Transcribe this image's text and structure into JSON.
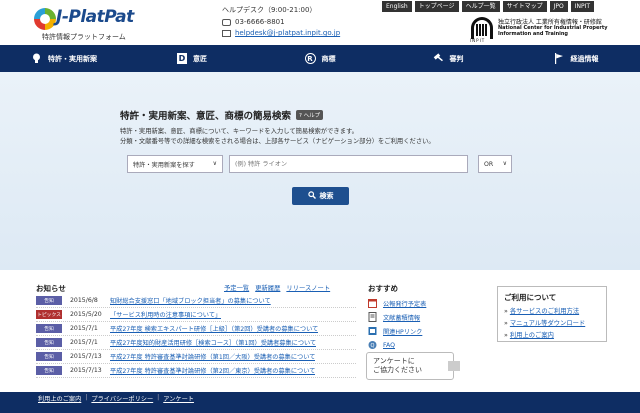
{
  "header": {
    "logo_text": "J-PlatPat",
    "logo_subtitle": "特許情報プラットフォーム",
    "helpdesk_title": "ヘルプデスク（9:00-21:00）",
    "helpdesk_phone": "03-6666-8801",
    "helpdesk_email": "helpdesk@j-platpat.inpit.go.jp",
    "top_links": [
      "English",
      "トップページ",
      "ヘルプ一覧",
      "サイトマップ",
      "JPO",
      "INPIT"
    ],
    "inpit_word": "INPIT",
    "inpit_jp": "独立行政法人 工業所有権情報・研修館",
    "inpit_en": "National Center for Industrial Property Information and Training"
  },
  "nav": {
    "items": [
      {
        "label": "特許・実用新案",
        "icon": "lightbulb-icon"
      },
      {
        "label": "意匠",
        "icon": "design-d-icon"
      },
      {
        "label": "商標",
        "icon": "trademark-r-icon"
      },
      {
        "label": "審判",
        "icon": "gavel-icon"
      },
      {
        "label": "経過情報",
        "icon": "flag-icon"
      }
    ]
  },
  "search": {
    "title": "特許・実用新案、意匠、商標の簡易検索",
    "help_label": "? ヘルプ",
    "desc_line1": "特許・実用新案、意匠、商標について、キーワードを入力して簡易検索ができます。",
    "desc_line2": "分類・文献番号等での詳細な検索をされる場合は、上部各サービス（ナビゲーション部分）をご利用ください。",
    "type_select_value": "特許・実用新案を探す",
    "keyword_placeholder": "(例) 特許 ライオン",
    "operator_value": "OR",
    "button_label": "検索"
  },
  "news": {
    "title": "お知らせ",
    "links": [
      "予定一覧",
      "更新履歴",
      "リリースノート"
    ],
    "items": [
      {
        "tag": "告知",
        "tag_color": "#5b5ea6",
        "date": "2015/6/8",
        "title": "知財総合支援窓口「地域ブロック担当者」の募集について"
      },
      {
        "tag": "トピックス",
        "tag_color": "#b03030",
        "date": "2015/5/20",
        "title": "「サービス利用時の注意事項について」"
      },
      {
        "tag": "告知",
        "tag_color": "#5b5ea6",
        "date": "2015/7/1",
        "title": "平成27年度 検索エキスパート研修［上級］（第2回）受講者の募集について"
      },
      {
        "tag": "告知",
        "tag_color": "#5b5ea6",
        "date": "2015/7/1",
        "title": "平成27年度知的財産活用研修［検索コース］（第1回）受講者募集について"
      },
      {
        "tag": "告知",
        "tag_color": "#5b5ea6",
        "date": "2015/7/13",
        "title": "平成27年度 特許審査基準討論研修（第1回／大阪）受講者の募集について"
      },
      {
        "tag": "告知",
        "tag_color": "#5b5ea6",
        "date": "2015/7/13",
        "title": "平成27年度 特許審査基準討論研修（第2回／東京）受講者の募集について"
      }
    ]
  },
  "recommend": {
    "title": "おすすめ",
    "items": [
      {
        "label": "公報発行予定表",
        "icon": "calendar-icon"
      },
      {
        "label": "文献蓄積情報",
        "icon": "document-icon"
      },
      {
        "label": "関連HPリンク",
        "icon": "link-icon"
      },
      {
        "label": "FAQ",
        "icon": "faq-icon"
      }
    ],
    "survey_line1": "アンケートに",
    "survey_line2": "ご協力ください"
  },
  "guide": {
    "title": "ご利用について",
    "items": [
      "各サービスのご利用方法",
      "マニュアル等ダウンロード",
      "利用上のご案内"
    ]
  },
  "footer": {
    "links": [
      "利用上のご案内",
      "プライバシーポリシー",
      "アンケート"
    ]
  }
}
